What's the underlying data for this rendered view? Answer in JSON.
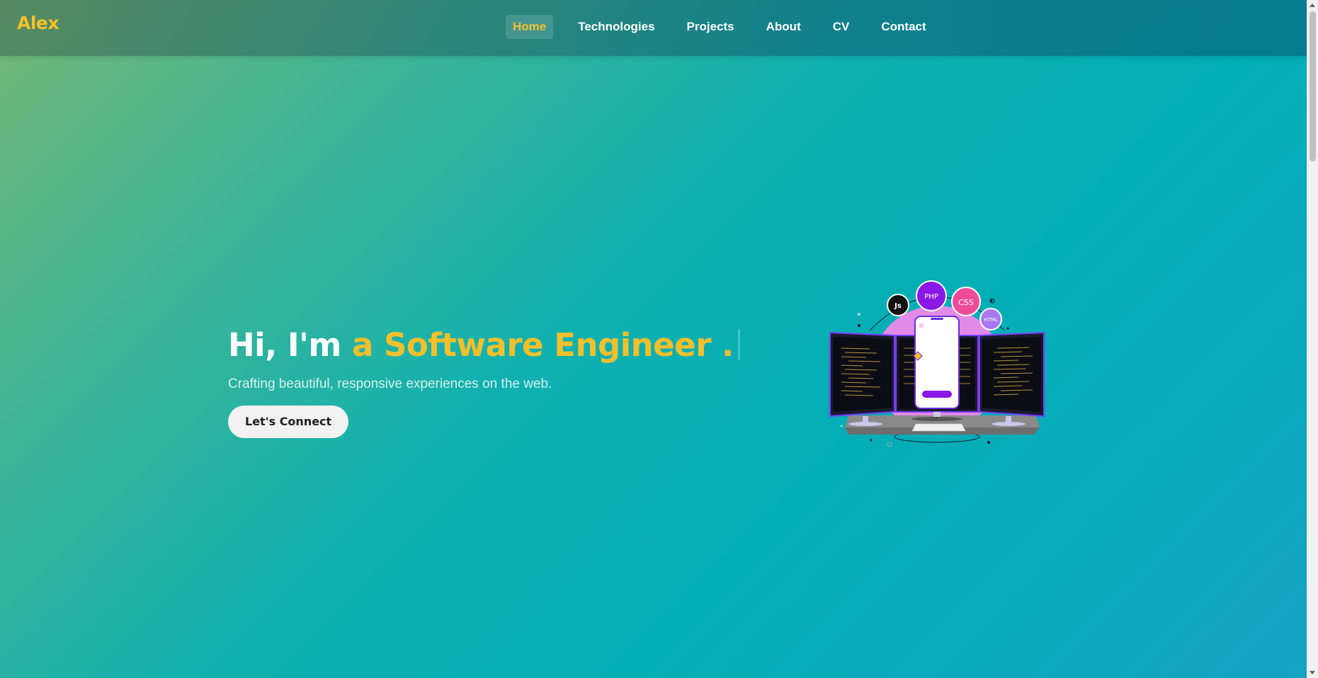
{
  "nav": {
    "logo": "Alex",
    "links": [
      {
        "label": "Home",
        "active": true
      },
      {
        "label": "Technologies",
        "active": false
      },
      {
        "label": "Projects",
        "active": false
      },
      {
        "label": "About",
        "active": false
      },
      {
        "label": "CV",
        "active": false
      },
      {
        "label": "Contact",
        "active": false
      }
    ]
  },
  "hero": {
    "greeting": "Hi, I'm ",
    "role": "a Software Engineer .",
    "subtitle": "Crafting beautiful, responsive experiences on the web.",
    "cta_label": "Let's Connect"
  },
  "illustration": {
    "badges": [
      "Js",
      "PHP",
      "CSS",
      "HTML"
    ]
  },
  "colors": {
    "accent": "#f5c02c",
    "text_light": "#ffffff",
    "button_bg": "#f2f2f2",
    "gradient_start": "#76b874",
    "gradient_mid": "#02aeb6",
    "gradient_end": "#16a1c4"
  }
}
